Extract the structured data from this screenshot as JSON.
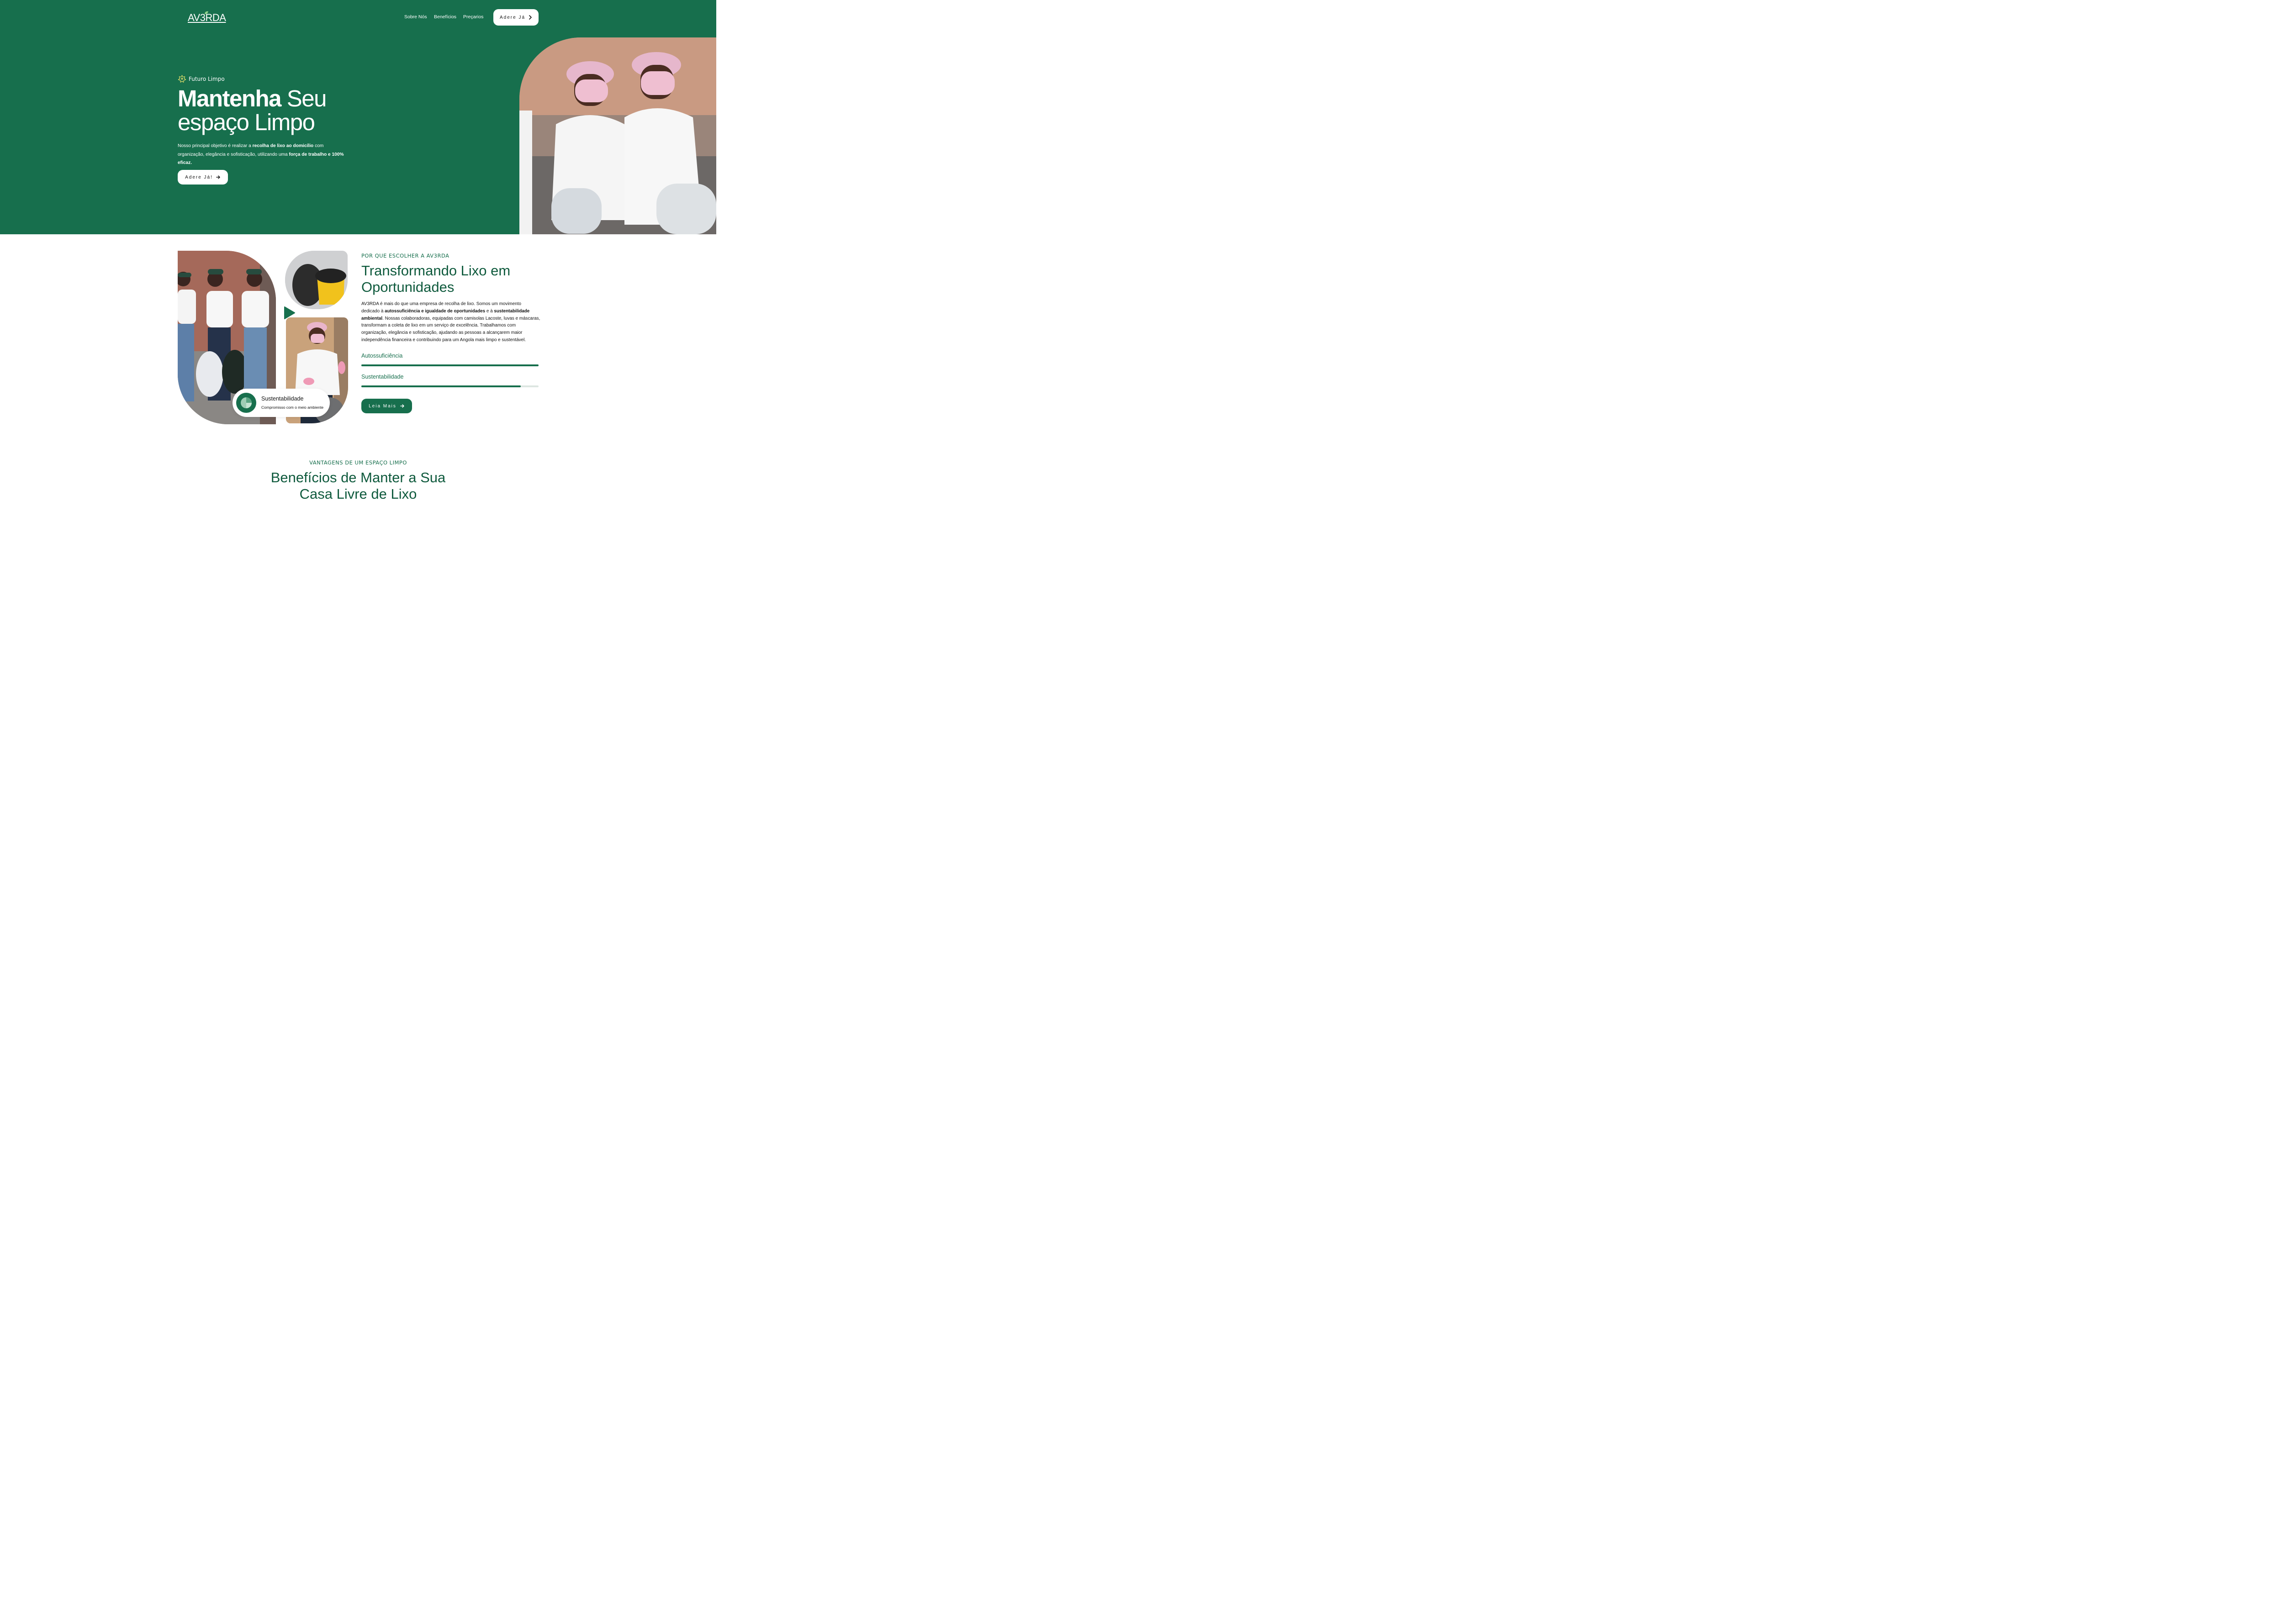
{
  "colors": {
    "brand_green": "#176f4d",
    "dark_green": "#0f5a3d",
    "white": "#ffffff"
  },
  "header": {
    "logo": "AV3RDA",
    "nav": [
      {
        "label": "Sobre Nós"
      },
      {
        "label": "Benefícios"
      },
      {
        "label": "Preçarios"
      }
    ],
    "cta_label": "Adere Já",
    "cta_icon": "chevron-right-icon"
  },
  "hero": {
    "eyebrow": "Futuro Limpo",
    "eyebrow_icon": "sparkle-badge-icon",
    "title_bold": "Mantenha",
    "title_rest_1": "Seu",
    "title_line2": "espaço Limpo",
    "text": {
      "p1": "Nosso principal objetivo é realizar a ",
      "b1": "recolha de lixo ao domicílio",
      "p2": " com organização, elegância e sofisticação, utilizando uma ",
      "b2": "força de trabalho e 100% eficaz."
    },
    "cta_label": "Adere Já!",
    "cta_icon": "arrow-right-icon"
  },
  "about": {
    "eyebrow": "POR QUE ESCOLHER A AV3RDA",
    "title_line1": "Transformando Lixo em",
    "title_line2": "Oportunidades",
    "text": {
      "p1": "AV3RDA é mais do que uma empresa de recolha de lixo. Somos um movimento dedicado à ",
      "b1": "autossuficiência e igualdade de oportunidades",
      "p2": " e à ",
      "b2": "sustentabilidade ambiental",
      "p3": ". Nossas colaboradoras, equipadas com camisolas Lacoste, luvas e máscaras, transformam a coleta de lixo em um serviço de excelência. Trabalhamos com organização, elegância e sofisticação, ajudando as pessoas a alcançarem maior independência financeira e contribuindo para um Angola mais limpo e sustentável."
    },
    "progress": [
      {
        "label": "Autossuficiência",
        "percent": 100
      },
      {
        "label": "Sustentabilidade",
        "percent": 90
      }
    ],
    "cta_label": "Leia Mais",
    "cta_icon": "arrow-right-icon",
    "play_icon": "play-icon",
    "badge": {
      "title": "Sustentabilidade",
      "subtitle": "Compromisso com o meio ambiente",
      "icon": "pie-chart-icon"
    }
  },
  "benefits": {
    "eyebrow": "VANTAGENS DE UM ESPAÇO LIMPO",
    "title_line1": "Benefícios de Manter a Sua",
    "title_line2": "Casa Livre de Lixo"
  }
}
